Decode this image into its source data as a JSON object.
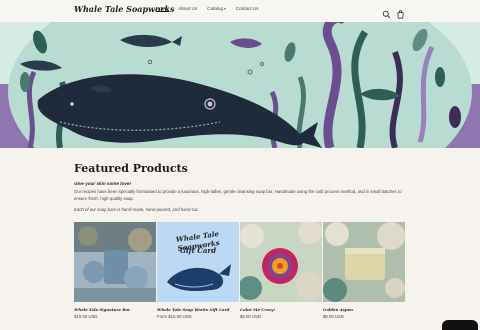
{
  "header": {
    "logo": "Whale Tale Soapworks",
    "nav": [
      {
        "label": "Home",
        "active": true
      },
      {
        "label": "About Us",
        "active": false
      },
      {
        "label": "Catalog",
        "active": false,
        "dropdown": true
      },
      {
        "label": "Contact Us",
        "active": false
      }
    ],
    "icons": [
      "search-icon",
      "cart-icon"
    ]
  },
  "hero": {
    "image": "illustration of whales, fish and kelp in teal and purple"
  },
  "featured": {
    "title": "Featured Products",
    "tagline": "Give your skin some love!",
    "description": "Our recipes have been specially formulated to provide a luxurious, high-lather, gentle cleansing soap bar. Handmade using the cold process method, and in small batches to ensure fresh, high-quality soap.",
    "note": "Each of our soap bars is hand-made, hand-poured, and hand-cut.",
    "products": [
      {
        "name": "Whale Tale Signature Bar",
        "price": "$10.00 USD"
      },
      {
        "name": "Whale Tale Soap Works Gift Card",
        "price": "From $10.00 USD"
      },
      {
        "name": "Color Me Crazy!",
        "price": "$6.00 USD"
      },
      {
        "name": "Golden Aspen",
        "price": "$8.00 USD"
      }
    ]
  },
  "gift_card": {
    "line1": "Whale Tale Soapworks",
    "line2": "Gift Card"
  },
  "colors": {
    "background": "#f6f3ef",
    "hero_teal": "#d6ebe4",
    "hero_purple": "#8f76b0",
    "dark": "#1f2a3a"
  }
}
